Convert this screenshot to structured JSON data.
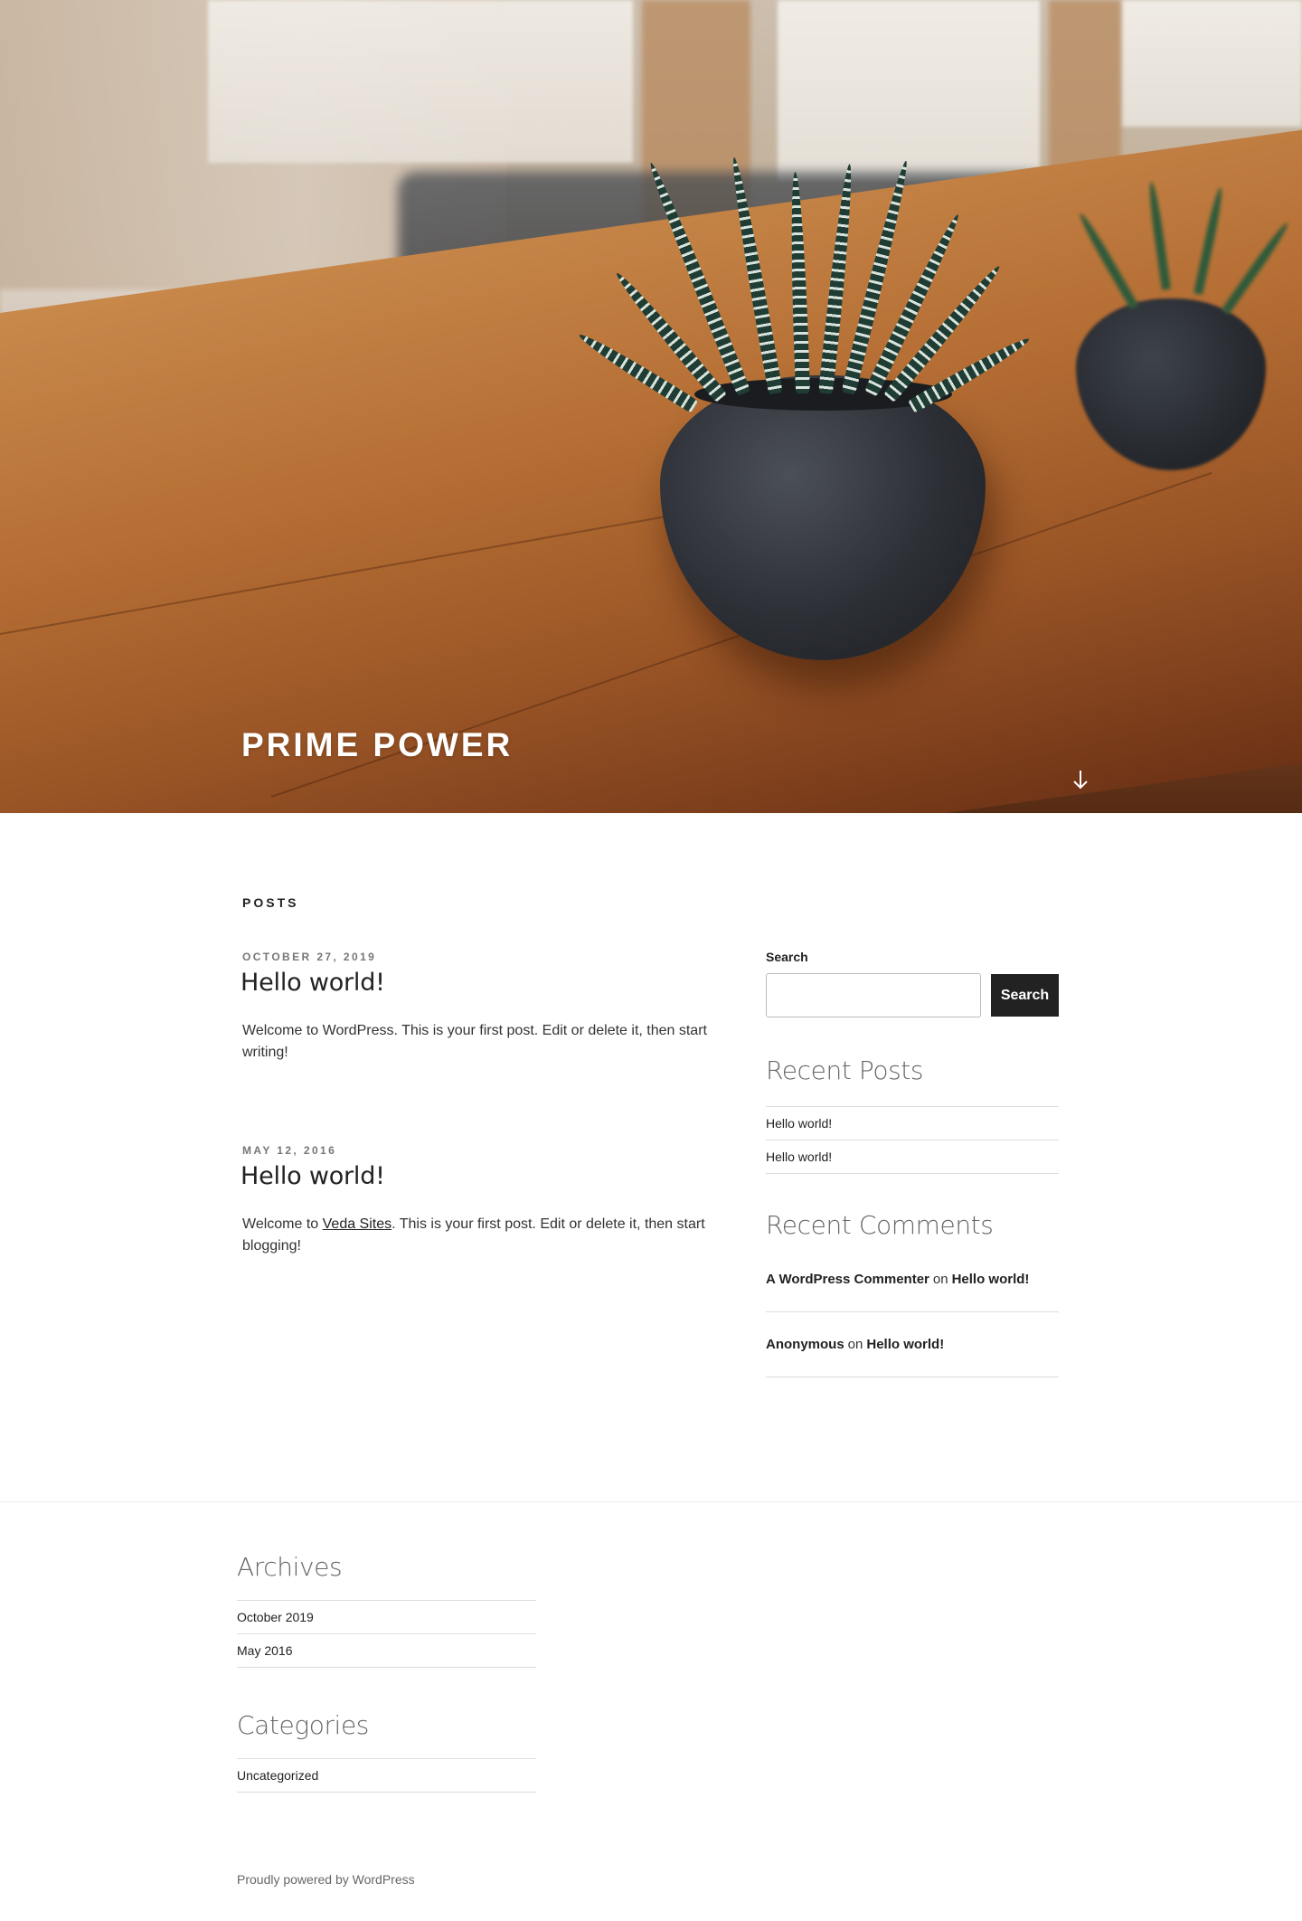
{
  "site": {
    "title": "PRIME POWER"
  },
  "header": {
    "scroll_icon": "arrow-down-icon"
  },
  "posts_section": {
    "heading": "POSTS",
    "posts": [
      {
        "date": "OCTOBER 27, 2019",
        "title": "Hello world!",
        "body": "Welcome to WordPress. This is your first post. Edit or delete it, then start writing!"
      },
      {
        "date": "MAY 12, 2016",
        "title": "Hello world!",
        "body_before_link": "Welcome to ",
        "link_text": "Veda Sites",
        "body_after_link": ". This is your first post. Edit or delete it, then start blogging!"
      }
    ]
  },
  "sidebar": {
    "search": {
      "label": "Search",
      "value": "",
      "button_label": "Search"
    },
    "recent_posts": {
      "title": "Recent Posts",
      "items": [
        "Hello world!",
        "Hello world!"
      ]
    },
    "recent_comments": {
      "title": "Recent Comments",
      "items": [
        {
          "author": "A WordPress Commenter",
          "on": "on",
          "post": "Hello world!"
        },
        {
          "author": "Anonymous",
          "on": "on",
          "post": "Hello world!"
        }
      ]
    }
  },
  "footer": {
    "archives": {
      "title": "Archives",
      "items": [
        "October 2019",
        "May 2016"
      ]
    },
    "categories": {
      "title": "Categories",
      "items": [
        "Uncategorized"
      ]
    },
    "powered_by": "Proudly powered by WordPress"
  }
}
